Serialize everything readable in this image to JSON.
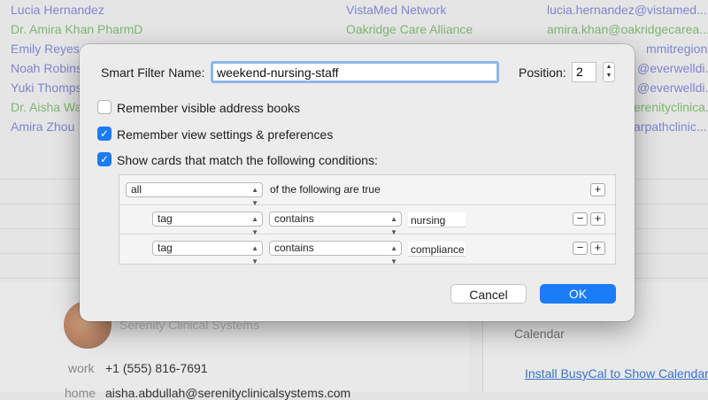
{
  "contacts": [
    {
      "name": "Lucia Hernandez",
      "org": "VistaMed Network",
      "email": "lucia.hernandez@vistamed...",
      "color": "blue"
    },
    {
      "name": "Dr. Amira Khan PharmD",
      "org": "Oakridge Care Alliance",
      "email": "amira.khan@oakridgecarea...",
      "color": "green"
    },
    {
      "name": "Emily Reyes",
      "org": "",
      "email": "mmitregion...",
      "color": "blue"
    },
    {
      "name": "Noah Robins",
      "org": "",
      "email": "@everwelldi...",
      "color": "blue"
    },
    {
      "name": "Yuki Thomps",
      "org": "",
      "email": "@everwelldi...",
      "color": "blue"
    },
    {
      "name": "Dr. Aisha Wa",
      "org": "",
      "email": "erenityclinica...",
      "color": "green"
    },
    {
      "name": "Amira Zhou",
      "org": "",
      "email": "arpathclinic...",
      "color": "blue"
    }
  ],
  "detail": {
    "org": "Serenity Clinical Systems",
    "phone_label": "work",
    "phone": "+1 (555) 816-7691",
    "email_label": "home",
    "email": "aisha.abdullah@serenityclinicalsystems.com"
  },
  "calendar": {
    "label": "Calendar",
    "install_link": "Install BusyCal to Show Calendar"
  },
  "dialog": {
    "name_label": "Smart Filter Name:",
    "name_value": "weekend-nursing-staff",
    "position_label": "Position:",
    "position_value": "2",
    "remember_books_label": "Remember visible address books",
    "remember_view_label": "Remember view settings & preferences",
    "show_cards_label": "Show cards that match the following conditions:",
    "remember_books_checked": false,
    "remember_view_checked": true,
    "show_cards_checked": true,
    "match_mode": "all",
    "match_suffix": "of the following are true",
    "conditions": [
      {
        "field": "tag",
        "operator": "contains",
        "value": "nursing"
      },
      {
        "field": "tag",
        "operator": "contains",
        "value": "compliance"
      }
    ],
    "cancel_label": "Cancel",
    "ok_label": "OK"
  },
  "colors": {
    "accent": "#1a7cf7",
    "contact_blue": "#7f86cf",
    "contact_green": "#7cb870",
    "link": "#3d73c9"
  }
}
